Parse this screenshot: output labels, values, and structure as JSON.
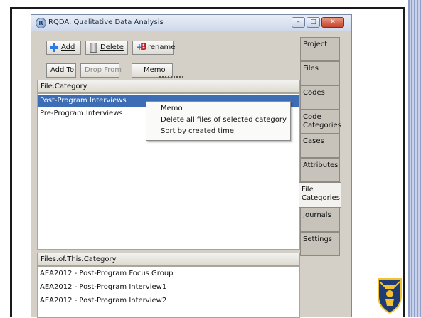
{
  "window": {
    "title": "RQDA: Qualitative Data Analysis",
    "controls": {
      "minimize": "–",
      "maximize": "□",
      "close": "✕"
    }
  },
  "toolbar": {
    "add_label": "Add",
    "delete_label": "Delete",
    "rename_label": "rename",
    "add_to_label": "Add To",
    "drop_from_label": "Drop From",
    "memo_label": "Memo"
  },
  "category_list": {
    "header": "File.Category",
    "items": [
      "Post-Program Interviews",
      "Pre-Program Interviews"
    ],
    "selected_index": 0
  },
  "context_menu": {
    "items": [
      "Memo",
      "Delete all files of selected category",
      "Sort by created time"
    ]
  },
  "files_list": {
    "header": "Files.of.This.Category",
    "items": [
      "AEA2012 - Post-Program Focus Group",
      "AEA2012 - Post-Program Interview1",
      "AEA2012 - Post-Program Interview2"
    ]
  },
  "tabs": [
    {
      "label": "Project"
    },
    {
      "label": "Files"
    },
    {
      "label": "Codes"
    },
    {
      "label": "Code Categories"
    },
    {
      "label": "Cases"
    },
    {
      "label": "Attributes"
    },
    {
      "label": "File Categories",
      "active": true
    },
    {
      "label": "Journals"
    },
    {
      "label": "Settings"
    }
  ],
  "colors": {
    "selection": "#3d6db5",
    "window_bg": "#d4d0c8",
    "logo_blue": "#1f3b73",
    "logo_gold": "#f2c230"
  },
  "icons": [
    "app-icon",
    "add-icon",
    "delete-icon",
    "rename-icon",
    "university-logo"
  ]
}
